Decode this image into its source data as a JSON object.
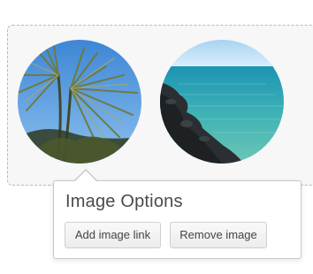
{
  "gallery": {
    "images": [
      {
        "subject": "palm fronds against blue sky"
      },
      {
        "subject": "rocky coastline with turquoise sea"
      }
    ]
  },
  "popover": {
    "title": "Image Options",
    "buttons": {
      "add_link": "Add image link",
      "remove": "Remove image"
    }
  },
  "colors": {
    "gallery_bg": "#f7f7f7",
    "gallery_border": "#b9b9b9",
    "popover_border": "#c8c8c8",
    "title_text": "#4a4a4a",
    "button_text": "#444444"
  }
}
